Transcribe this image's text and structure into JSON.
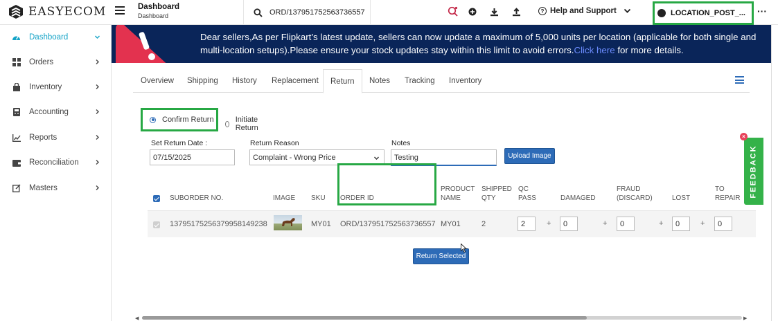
{
  "app": {
    "logo_text": "EASYECOM"
  },
  "header": {
    "title": "Dashboard",
    "subtitle": "Dashboard",
    "search_value": "ORD/137951752563736557",
    "help_label": "Help and Support",
    "location_label": "LOCATION_POST_...",
    "more_label": "···"
  },
  "sidebar": {
    "items": [
      {
        "label": "Dashboard",
        "icon": "dashboard-gauge-icon",
        "active": true
      },
      {
        "label": "Orders",
        "icon": "grid-icon"
      },
      {
        "label": "Inventory",
        "icon": "bag-icon"
      },
      {
        "label": "Accounting",
        "icon": "ledger-icon"
      },
      {
        "label": "Reports",
        "icon": "chart-line-icon"
      },
      {
        "label": "Reconciliation",
        "icon": "wallet-icon"
      },
      {
        "label": "Masters",
        "icon": "edit-icon"
      }
    ]
  },
  "banner": {
    "line1": "Dear sellers,As per Flipkart’s latest update, sellers can now update a maximum of 5,000 units per location (applicable for both single and",
    "line2_before": "multi-location setups).Please ensure your stock updates stay within this limit to avoid errors.",
    "link_text": "Click here",
    "line2_after": " for more details."
  },
  "tabs": [
    "Overview",
    "Shipping",
    "History",
    "Replacement",
    "Return",
    "Notes",
    "Tracking",
    "Inventory"
  ],
  "active_tab": "Return",
  "return_form": {
    "option_confirm": "Confirm Return",
    "option_initiate": "Initiate Return",
    "date_label": "Set Return Date :",
    "date_value": "07/15/2025",
    "reason_label": "Return Reason",
    "reason_value": "Complaint - Wrong Price",
    "notes_label": "Notes",
    "notes_value": "Testing",
    "upload_label": "Upload Image"
  },
  "table": {
    "headers": {
      "suborder": "SUBORDER NO.",
      "image": "IMAGE",
      "sku": "SKU",
      "order_id": "ORDER ID",
      "product_name_1": "PRODUCT",
      "product_name_2": "NAME",
      "shipped_1": "SHIPPED",
      "shipped_2": "QTY",
      "qc_1": "QC",
      "qc_2": "PASS",
      "damaged": "DAMAGED",
      "fraud_1": "FRAUD",
      "fraud_2": "(DISCARD)",
      "lost": "LOST",
      "repair_1": "TO",
      "repair_2": "REPAIR"
    },
    "row": {
      "suborder": "137951752563799581492​38",
      "sku": "MY01",
      "order_id": "ORD/137951752563736557",
      "product_name": "MY01",
      "shipped_qty": "2",
      "qc_pass": "2",
      "damaged": "0",
      "fraud": "0",
      "lost": "0",
      "repair": "0"
    },
    "plus": "+"
  },
  "return_selected_label": "Return Selected",
  "feedback": {
    "label": "FEEDBACK",
    "close": "×"
  },
  "colors": {
    "accent": "#2d6bb7",
    "active_nav": "#14a3c7",
    "highlight": "#27a844",
    "banner_bg": "#0a2559",
    "feedback": "#34b249"
  }
}
